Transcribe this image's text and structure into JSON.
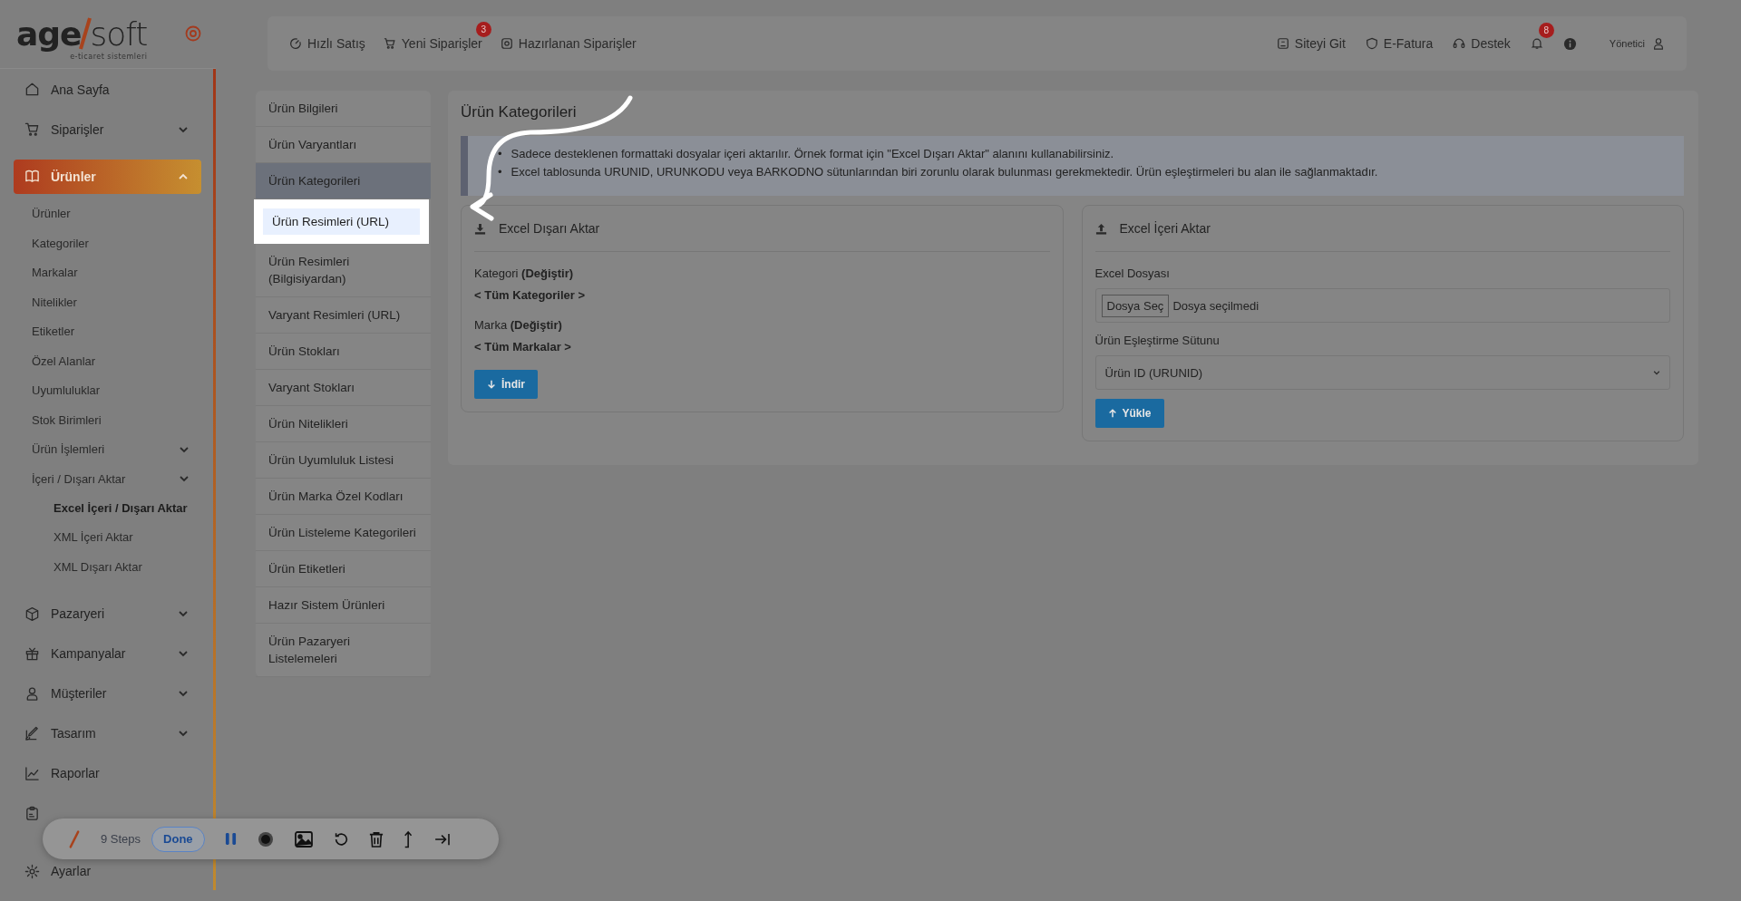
{
  "logo": {
    "first": "age",
    "second": "soft",
    "tagline": "e-ticaret sistemleri"
  },
  "sidebar": {
    "items": [
      {
        "label": "Ana Sayfa",
        "selected": false
      },
      {
        "label": "Siparişler",
        "selected": false,
        "expanded": false
      },
      {
        "label": "Ürünler",
        "selected": true,
        "expanded": true,
        "children": [
          {
            "label": "Ürünler",
            "selected": false
          },
          {
            "label": "Kategoriler",
            "selected": false
          },
          {
            "label": "Markalar",
            "selected": false
          },
          {
            "label": "Nitelikler",
            "selected": false
          },
          {
            "label": "Etiketler",
            "selected": false
          },
          {
            "label": "Özel Alanlar",
            "selected": false
          },
          {
            "label": "Uyumluluklar",
            "selected": false
          },
          {
            "label": "Stok Birimleri",
            "selected": false
          },
          {
            "label": "Ürün İşlemleri",
            "selected": false,
            "expanded": false
          },
          {
            "label": "İçeri / Dışarı Aktar",
            "selected": false,
            "expanded": true,
            "children": [
              {
                "label": "Excel İçeri / Dışarı Aktar",
                "selected": true
              },
              {
                "label": "XML İçeri Aktar",
                "selected": false
              },
              {
                "label": "XML Dışarı Aktar",
                "selected": false
              }
            ]
          }
        ]
      },
      {
        "label": "Pazaryeri",
        "selected": false,
        "expanded": false
      },
      {
        "label": "Kampanyalar",
        "selected": false,
        "expanded": false
      },
      {
        "label": "Müşteriler",
        "selected": false,
        "expanded": false
      },
      {
        "label": "Tasarım",
        "selected": false,
        "expanded": false
      },
      {
        "label": "Raporlar",
        "selected": false
      },
      {
        "selected": false
      },
      {
        "label": "Ayarlar",
        "selected": false
      }
    ]
  },
  "header": {
    "left_links": [
      {
        "label": "Hızlı Satış"
      },
      {
        "label": "Yeni Siparişler",
        "badge": "3"
      },
      {
        "label": "Hazırlanan Siparişler"
      }
    ],
    "right_links": [
      {
        "label": "Siteyi Git"
      },
      {
        "label": "E-Fatura"
      },
      {
        "label": "Destek"
      }
    ],
    "notifications_badge": "8",
    "user": "Yönetici"
  },
  "submenu": [
    {
      "label": "Ürün Bilgileri",
      "selected": false,
      "highlighted": false
    },
    {
      "label": "Ürün Varyantları",
      "selected": false,
      "highlighted": false
    },
    {
      "label": "Ürün Kategorileri",
      "selected": true,
      "highlighted": false
    },
    {
      "label": "Ürün Resimleri (URL)",
      "selected": false,
      "highlighted": true
    },
    {
      "label": "Ürün Resimleri (Bilgisiyardan)",
      "selected": false,
      "highlighted": false
    },
    {
      "label": "Varyant Resimleri (URL)",
      "selected": false,
      "highlighted": false
    },
    {
      "label": "Ürün Stokları",
      "selected": false,
      "highlighted": false
    },
    {
      "label": "Varyant Stokları",
      "selected": false,
      "highlighted": false
    },
    {
      "label": "Ürün Nitelikleri",
      "selected": false,
      "highlighted": false
    },
    {
      "label": "Ürün Uyumluluk Listesi",
      "selected": false,
      "highlighted": false
    },
    {
      "label": "Ürün Marka Özel Kodları",
      "selected": false,
      "highlighted": false
    },
    {
      "label": "Ürün Listeleme Kategorileri",
      "selected": false,
      "highlighted": false
    },
    {
      "label": "Ürün Etiketleri",
      "selected": false,
      "highlighted": false
    },
    {
      "label": "Hazır Sistem Ürünleri",
      "selected": false,
      "highlighted": false
    },
    {
      "label": "Ürün Pazaryeri Listelemeleri",
      "selected": false,
      "highlighted": false
    }
  ],
  "main": {
    "title": "Ürün Kategorileri",
    "notes": [
      {
        "bullet": "•",
        "text": "Sadece desteklenen formattaki dosyalar içeri aktarılır. Örnek format için \"Excel Dışarı Aktar\" alanını kullanabilirsiniz."
      },
      {
        "bullet": "•",
        "text": "Excel tablosunda URUNID, URUNKODU veya BARKODNO sütunlarından biri zorunlu olarak bulunması gerekmektedir. Ürün eşleştirmeleri bu alan ile sağlanmaktadır."
      }
    ],
    "export": {
      "title": "Excel Dışarı Aktar",
      "filters": [
        {
          "label": "Kategori",
          "action": "(Değiştir)",
          "value": "< Tüm Kategoriler >"
        },
        {
          "label": "Marka",
          "action": "(Değiştir)",
          "value": "< Tüm Markalar >"
        }
      ],
      "button": "İndir"
    },
    "import": {
      "title": "Excel İçeri Aktar",
      "file_label": "Excel Dosyası",
      "file_button": "Dosya Seç",
      "file_status": "Dosya seçilmedi",
      "match_label": "Ürün Eşleştirme Sütunu",
      "match_value": "Ürün ID (URUNID)",
      "button": "Yükle"
    }
  },
  "recorder": {
    "steps": "9 Steps",
    "done": "Done",
    "paused": false
  }
}
